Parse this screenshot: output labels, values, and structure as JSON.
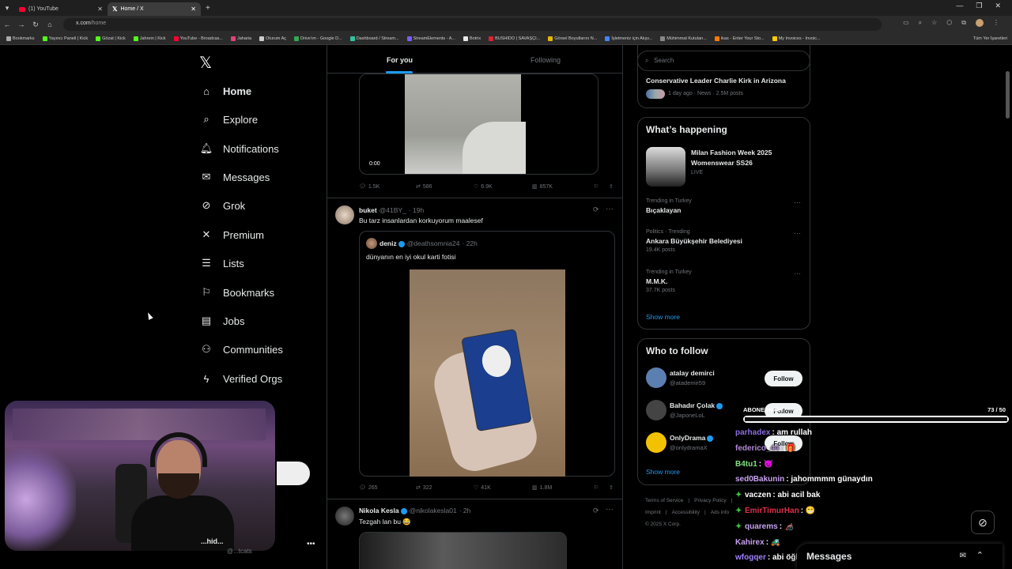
{
  "browser": {
    "tabs": [
      {
        "label": "(1) YouTube",
        "favicon": "youtube-icon",
        "active": false
      },
      {
        "label": "Home / X",
        "favicon": "x-icon",
        "active": true
      }
    ],
    "new_tab": "+",
    "url_host": "x.com",
    "url_path": "/home",
    "bookmarks": [
      {
        "label": "Bookmarks",
        "color": "#aaaaaa"
      },
      {
        "label": "Yayıncı Paneli | Kick",
        "color": "#53fc18"
      },
      {
        "label": "Gözat | Kick",
        "color": "#53fc18"
      },
      {
        "label": "Jahrein | Kick",
        "color": "#53fc18"
      },
      {
        "label": "YouTube - Broadcas...",
        "color": "#ff0033"
      },
      {
        "label": "Jaharia",
        "color": "#e0447a"
      },
      {
        "label": "Oturum Aç",
        "color": "#cccccc"
      },
      {
        "label": "Drive'ım - Google D...",
        "color": "#34a853"
      },
      {
        "label": "Dashboard / Stream...",
        "color": "#31c3a2"
      },
      {
        "label": "StreamElements - A...",
        "color": "#7b5cff"
      },
      {
        "label": "Botrix",
        "color": "#e8e8e8"
      },
      {
        "label": "BUSHIDO | SAVAŞÇI...",
        "color": "#d23"
      },
      {
        "label": "Görsel Boyutlarını N...",
        "color": "#e6b800"
      },
      {
        "label": "İşletmeniz için Alışv...",
        "color": "#4285f4"
      },
      {
        "label": "Mühimmat Kutuları...",
        "color": "#888888"
      },
      {
        "label": "ikas - Enter Your Sto...",
        "color": "#ff7a00"
      },
      {
        "label": "My Invoices - Invoic...",
        "color": "#ffcc00"
      }
    ],
    "all_bookmarks": "Tüm Yer İşaretleri"
  },
  "nav": {
    "items": [
      {
        "label": "Home",
        "icon": "home-icon",
        "glyph": "⌂"
      },
      {
        "label": "Explore",
        "icon": "search-icon",
        "glyph": "⌕"
      },
      {
        "label": "Notifications",
        "icon": "bell-icon",
        "glyph": "🔔︎"
      },
      {
        "label": "Messages",
        "icon": "mail-icon",
        "glyph": "✉"
      },
      {
        "label": "Grok",
        "icon": "grok-icon",
        "glyph": "⊘"
      },
      {
        "label": "Premium",
        "icon": "x-premium-icon",
        "glyph": "✕"
      },
      {
        "label": "Lists",
        "icon": "list-icon",
        "glyph": "☰"
      },
      {
        "label": "Bookmarks",
        "icon": "bookmark-icon",
        "glyph": "⚐"
      },
      {
        "label": "Jobs",
        "icon": "briefcase-icon",
        "glyph": "▤"
      },
      {
        "label": "Communities",
        "icon": "people-icon",
        "glyph": "⚇"
      },
      {
        "label": "Verified Orgs",
        "icon": "lightning-icon",
        "glyph": "ϟ"
      }
    ],
    "account_name": "...hid...",
    "account_handle": "@...tcats"
  },
  "feed": {
    "tab_foryou": "For you",
    "tab_following": "Following",
    "post1": {
      "video_time": "0:00",
      "replies": "1.5K",
      "reposts": "586",
      "likes": "6.9K",
      "views": "857K"
    },
    "post2": {
      "name": "buket",
      "handle": "@41BY_",
      "time": "· 19h",
      "text": "Bu tarz insanlardan korkuyorum maalesef",
      "quote_name": "deniz",
      "quote_handle": "@deathsomnia24",
      "quote_time": "· 22h",
      "quote_text": "dünyanın en iyi okul karti fotisi",
      "replies": "265",
      "reposts": "322",
      "likes": "41K",
      "views": "1.8M"
    },
    "post3": {
      "name": "Nikola Kesla",
      "handle": "@nikolakesla01",
      "time": "· 2h",
      "text": "Tezgah lan bu 😂"
    }
  },
  "right": {
    "search_placeholder": "Search",
    "news": {
      "title": "Conservative Leader Charlie Kirk in Arizona",
      "meta": "1 day ago · News · 2.5M posts"
    },
    "happening_title": "What’s happening",
    "fashion": {
      "line1": "Milan Fashion Week 2025",
      "line2": "Womenswear SS26",
      "live": "LIVE"
    },
    "trends": [
      {
        "context": "Trending in Turkey",
        "name": "Bıçaklayan",
        "count": ""
      },
      {
        "context": "Politics · Trending",
        "name": "Ankara Büyükşehir Belediyesi",
        "count": "19.4K posts"
      },
      {
        "context": "Trending in Turkey",
        "name": "M.M.K.",
        "count": "37.7K posts"
      }
    ],
    "show_more": "Show more",
    "wtf_title": "Who to follow",
    "wtf": [
      {
        "name": "atalay demirci",
        "handle": "@atademir59",
        "verified": false,
        "color": "#5b7fb0"
      },
      {
        "name": "Bahadır Çolak",
        "handle": "@JaponeLoL",
        "verified": true,
        "color": "#444444"
      },
      {
        "name": "OnlyDrama",
        "handle": "@onlydramaX",
        "verified": true,
        "color": "#f2c200"
      }
    ],
    "follow_label": "Follow",
    "wtf_show_more": "Show more",
    "footer": [
      "Terms of Service",
      "|",
      "Privacy Policy",
      "|",
      "Imprint",
      "|",
      "Accessibility",
      "|",
      "Ads info",
      "© 2025 X Corp."
    ]
  },
  "overlay": {
    "goal_label": "ABONE Hedef",
    "goal_count": "73  / 50",
    "goal_fraction": 1.0,
    "chat": [
      {
        "user": "parhadex",
        "color": "#8a6ee0",
        "msg": ": am rullah",
        "badge": false
      },
      {
        "user": "federico_44",
        "color": "#b38ad8",
        "msg": ": 🎁",
        "badge": false
      },
      {
        "user": "B4tu1",
        "color": "#7fe07f",
        "msg": ": 😈",
        "badge": false
      },
      {
        "user": "sed0Bakunin",
        "color": "#c8a2f0",
        "msg": ": jahommmm günaydın",
        "badge": false
      },
      {
        "user": "vaczen",
        "color": "#ffffff",
        "msg": ": abi acil bak",
        "badge": true
      },
      {
        "user": "EmirTimurHan",
        "color": "#e0304a",
        "msg": ": 😁",
        "badge": true
      },
      {
        "user": "quarems",
        "color": "#c8a2f0",
        "msg": ": 🦽",
        "badge": true
      },
      {
        "user": "Kahirex",
        "color": "#c8a2f0",
        "msg": ": 🚜",
        "badge": false
      },
      {
        "user": "wfogqer",
        "color": "#9f80ff",
        "msg": ": abi öğlen lolü",
        "badge": false
      }
    ],
    "messages_label": "Messages"
  }
}
